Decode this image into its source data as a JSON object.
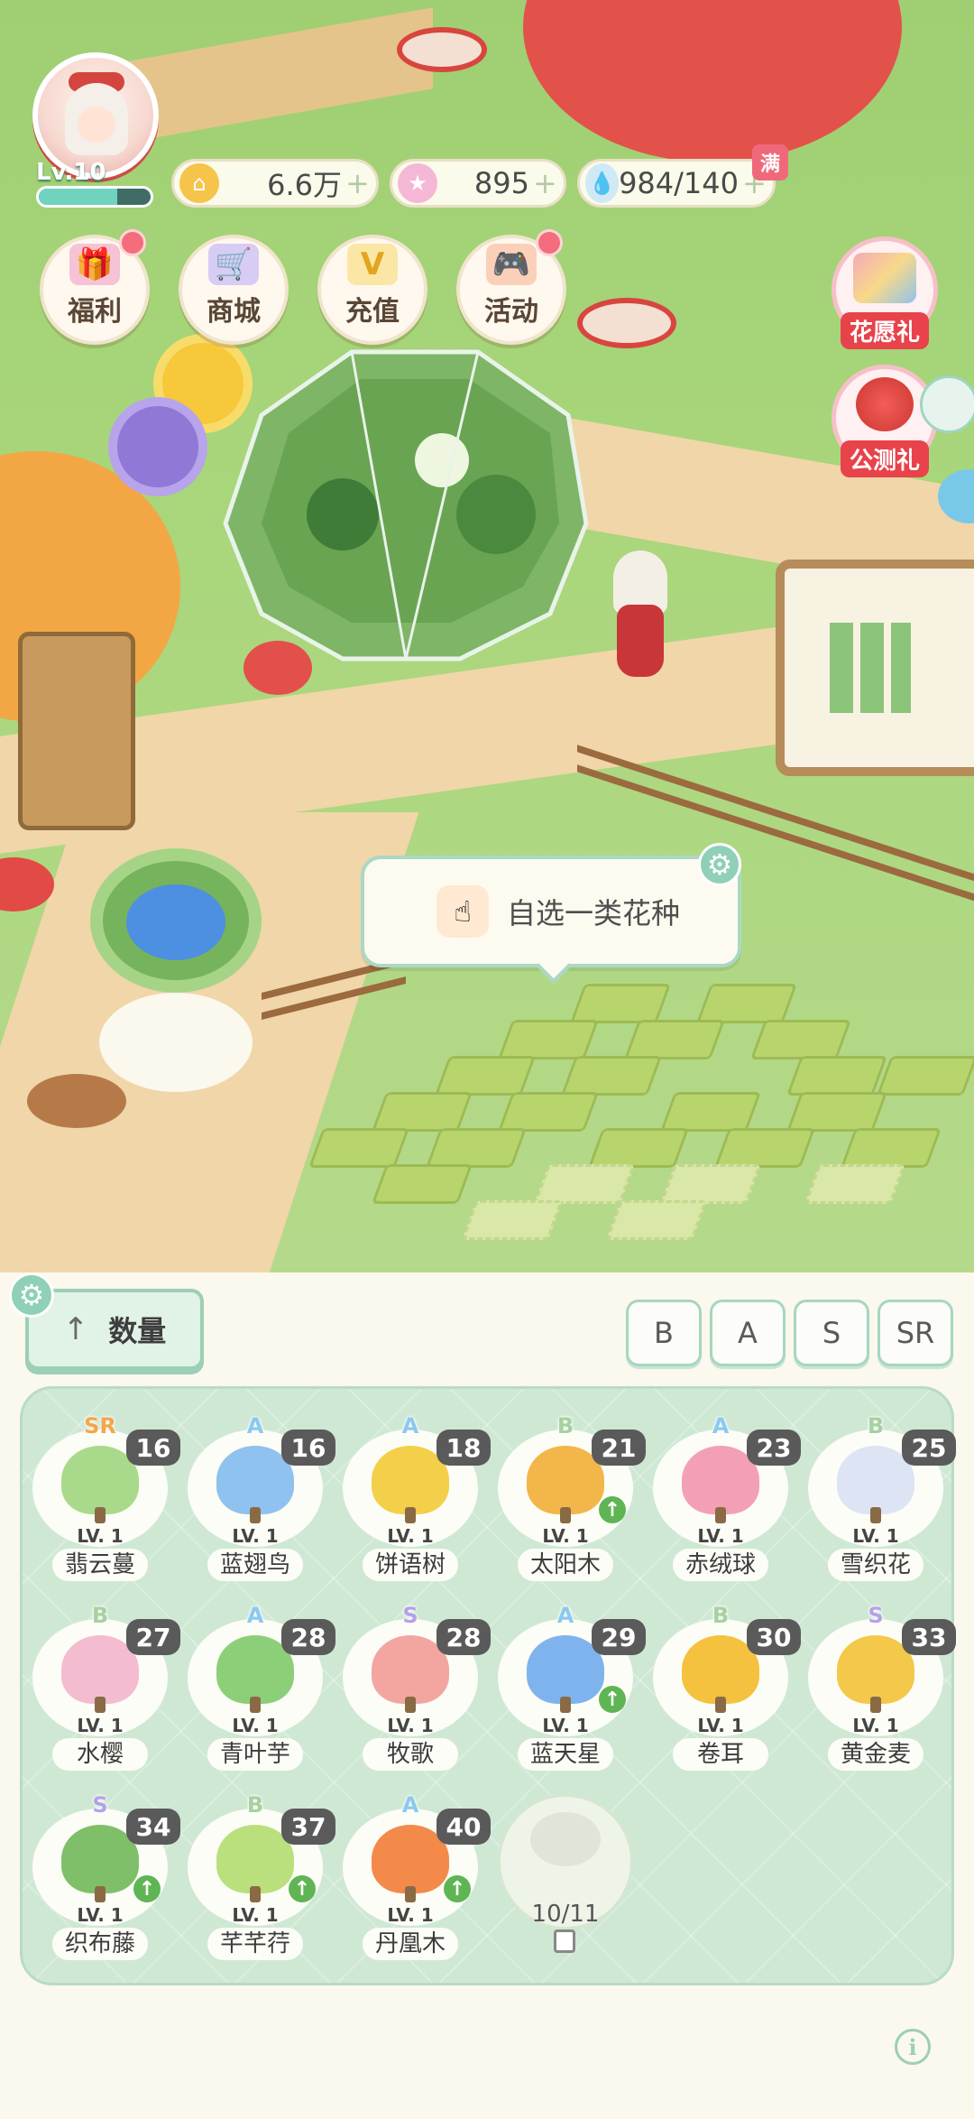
{
  "player": {
    "level": "Lv.10",
    "exp_fraction": 0.7
  },
  "resources": [
    {
      "name": "gold",
      "icon": "coin-icon",
      "value": "6.6万"
    },
    {
      "name": "star",
      "icon": "star-icon",
      "value": "895"
    },
    {
      "name": "water",
      "icon": "water-drop-icon",
      "value": "984/140",
      "badge": "满"
    }
  ],
  "menu": [
    {
      "label": "福利",
      "icon": "gift-icon",
      "color": "#f6a8c8"
    },
    {
      "label": "商城",
      "icon": "cart-icon",
      "color": "#b7a4ea"
    },
    {
      "label": "充值",
      "icon": "v-diamond-icon",
      "color": "#f3c33f"
    },
    {
      "label": "活动",
      "icon": "gamepad-icon",
      "color": "#f39a6b"
    }
  ],
  "side": [
    {
      "label": "花愿礼"
    },
    {
      "label": "公测礼"
    }
  ],
  "tooltip": {
    "text": "自选一类花种"
  },
  "toolbar": {
    "sort_label": "数量",
    "ranks": [
      "B",
      "A",
      "S",
      "SR"
    ]
  },
  "plants": [
    {
      "name": "翡云蔓",
      "rarity": "SR",
      "count": "16",
      "level": "LV. 1",
      "color": "#a9d98a",
      "rarity_color": "#f3a64a",
      "upgrade": false
    },
    {
      "name": "蓝翅鸟",
      "rarity": "A",
      "count": "16",
      "level": "LV. 1",
      "color": "#8fc2ee",
      "rarity_color": "#8cc9ee",
      "upgrade": false
    },
    {
      "name": "饼语树",
      "rarity": "A",
      "count": "18",
      "level": "LV. 1",
      "color": "#f4cf4a",
      "rarity_color": "#8cc9ee",
      "upgrade": false
    },
    {
      "name": "太阳木",
      "rarity": "B",
      "count": "21",
      "level": "LV. 1",
      "color": "#f3b64a",
      "rarity_color": "#a7d1a0",
      "upgrade": true
    },
    {
      "name": "赤绒球",
      "rarity": "A",
      "count": "23",
      "level": "LV. 1",
      "color": "#f3a0b6",
      "rarity_color": "#8cc9ee",
      "upgrade": false
    },
    {
      "name": "雪织花",
      "rarity": "B",
      "count": "25",
      "level": "LV. 1",
      "color": "#dde4f4",
      "rarity_color": "#a7d1a0",
      "upgrade": false
    },
    {
      "name": "水樱",
      "rarity": "B",
      "count": "27",
      "level": "LV. 1",
      "color": "#f4bcd0",
      "rarity_color": "#a7d1a0",
      "upgrade": false
    },
    {
      "name": "青叶芋",
      "rarity": "A",
      "count": "28",
      "level": "LV. 1",
      "color": "#8ccf78",
      "rarity_color": "#8cc9ee",
      "upgrade": false
    },
    {
      "name": "牧歌",
      "rarity": "S",
      "count": "28",
      "level": "LV. 1",
      "color": "#f3a6a0",
      "rarity_color": "#b5a1e8",
      "upgrade": false
    },
    {
      "name": "蓝天星",
      "rarity": "A",
      "count": "29",
      "level": "LV. 1",
      "color": "#7fb3ee",
      "rarity_color": "#8cc9ee",
      "upgrade": true
    },
    {
      "name": "卷耳",
      "rarity": "B",
      "count": "30",
      "level": "LV. 1",
      "color": "#f4c23e",
      "rarity_color": "#a7d1a0",
      "upgrade": false
    },
    {
      "name": "黄金麦",
      "rarity": "S",
      "count": "33",
      "level": "LV. 1",
      "color": "#f4c84a",
      "rarity_color": "#b5a1e8",
      "upgrade": false
    },
    {
      "name": "织布藤",
      "rarity": "S",
      "count": "34",
      "level": "LV. 1",
      "color": "#7fbf6a",
      "rarity_color": "#b5a1e8",
      "upgrade": true
    },
    {
      "name": "芊芊荇",
      "rarity": "B",
      "count": "37",
      "level": "LV. 1",
      "color": "#b9e07c",
      "rarity_color": "#a7d1a0",
      "upgrade": true
    },
    {
      "name": "丹凰木",
      "rarity": "A",
      "count": "40",
      "level": "LV. 1",
      "color": "#f38a4a",
      "rarity_color": "#8cc9ee",
      "upgrade": true
    }
  ],
  "locked_slot": {
    "text": "10/11"
  }
}
